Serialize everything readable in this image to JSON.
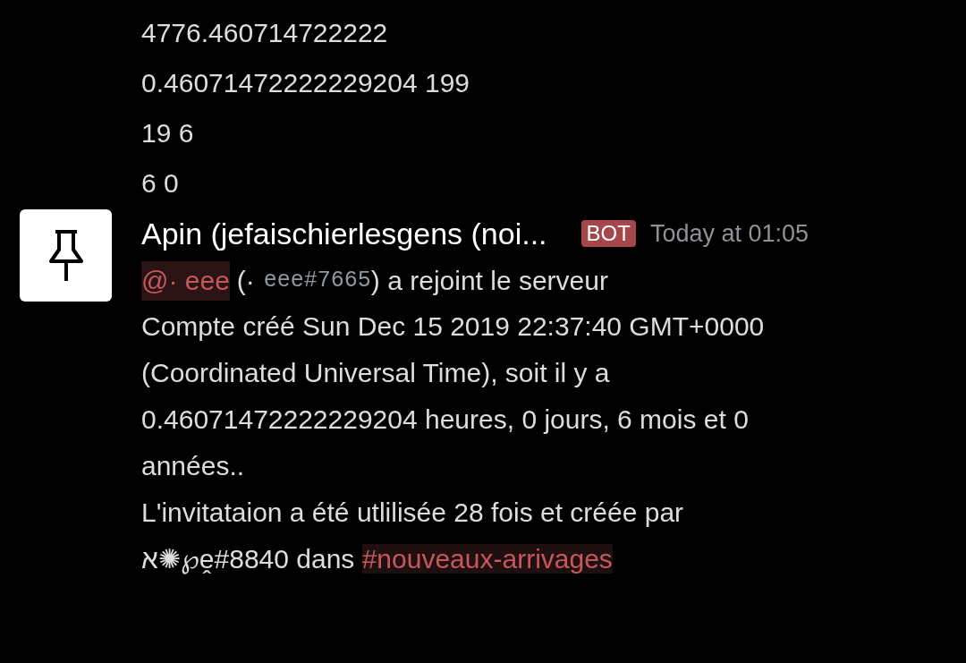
{
  "previous_message": {
    "lines": [
      "4776.460714722222",
      "0.46071472222229204 199",
      "19 6",
      "6 0"
    ]
  },
  "message": {
    "author": "Apin (jefaischierlesgens (noi...",
    "badge": "BOT",
    "timestamp": "Today at 01:05",
    "join_line": {
      "mention": "@· eee",
      "open": "(· ",
      "tag": "eee#7665",
      "rest": ") a rejoint le serveur"
    },
    "account_lines": [
      "Compte créé Sun Dec 15 2019 22:37:40 GMT+0000",
      "(Coordinated Universal Time), soit il y a",
      "0.46071472222229204 heures, 0 jours, 6 mois et 0",
      "années.."
    ],
    "invite": {
      "line_1": "L'invitataion a été utlilisée 28 fois et créée par",
      "line_2": "א✺℘ḙ#8840 dans ",
      "channel": "#nouveaux-arrivages"
    }
  }
}
